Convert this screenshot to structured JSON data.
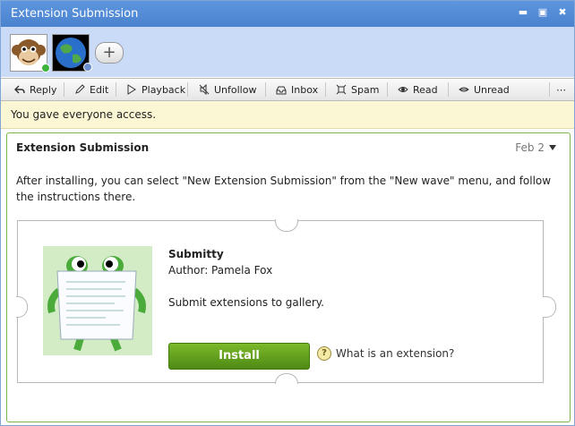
{
  "window": {
    "title": "Extension Submission",
    "controls": [
      {
        "name": "minimize-button",
        "glyph": "▬"
      },
      {
        "name": "maximize-button",
        "glyph": "▣"
      },
      {
        "name": "close-button",
        "glyph": "✖"
      }
    ]
  },
  "participants": {
    "avatars": [
      "monkey-avatar",
      "globe-avatar"
    ],
    "add_label": "+"
  },
  "toolbar": {
    "reply": "Reply",
    "edit": "Edit",
    "playback": "Playback",
    "unfollow": "Unfollow",
    "inbox": "Inbox",
    "spam": "Spam",
    "read": "Read",
    "unread": "Unread",
    "more": "⋯"
  },
  "banner": {
    "text": "You gave everyone access."
  },
  "blip": {
    "title": "Extension Submission",
    "date": "Feb 2",
    "body": "After installing, you can select \"New Extension Submission\" from the \"New wave\" menu, and follow the instructions there."
  },
  "extension": {
    "name": "Submitty",
    "author": "Author: Pamela Fox",
    "description": "Submit extensions to gallery.",
    "install_label": "Install",
    "help_text": "What is an extension?",
    "help_icon": "?"
  },
  "colors": {
    "titlebar": "#4a82cf",
    "participants_bg": "#c9dbf6",
    "banner_bg": "#fbf7d4",
    "blip_border": "#7ab648",
    "install_green": "#5c9a1a"
  }
}
